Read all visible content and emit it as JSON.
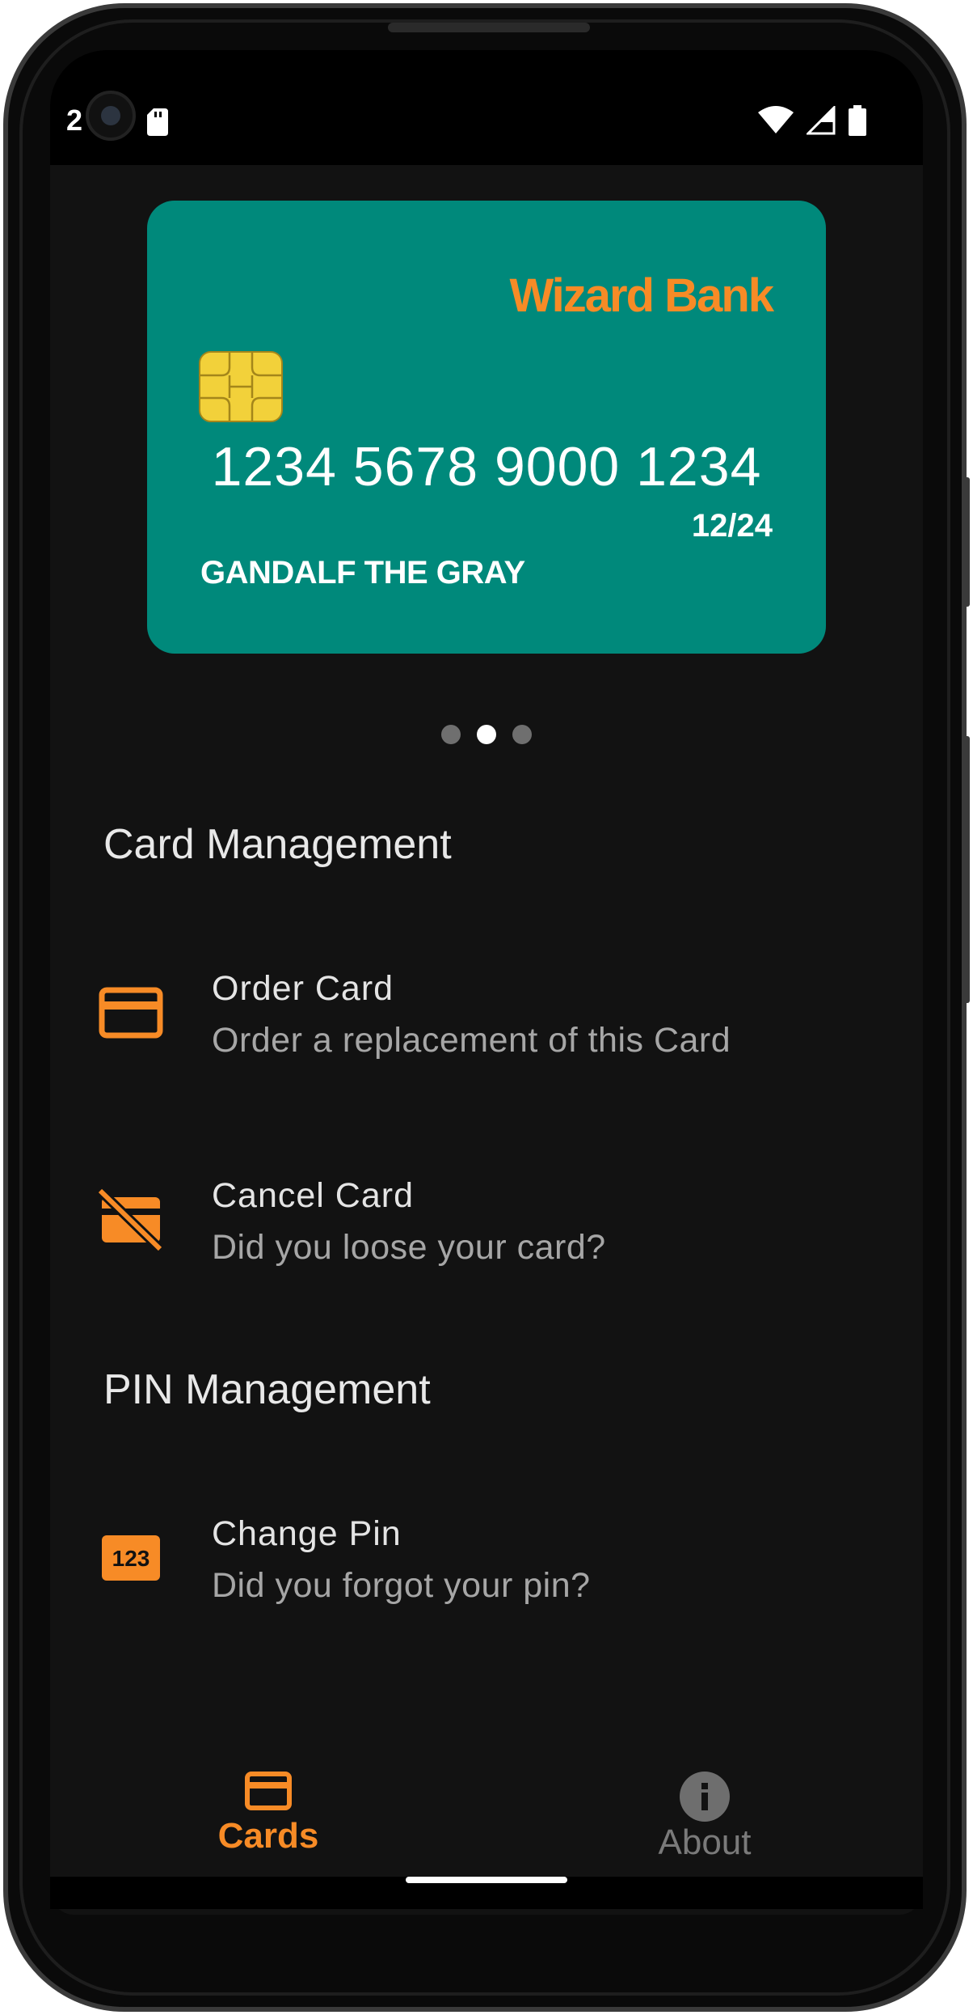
{
  "status_bar": {
    "time": "2",
    "icons": [
      "sd-card-icon",
      "wifi-icon",
      "signal-icon",
      "battery-icon"
    ]
  },
  "card": {
    "bank_name": "Wizard Bank",
    "number": "1234 5678 9000 1234",
    "expiry": "12/24",
    "holder": "GANDALF THE GRAY",
    "color": "#00897b",
    "accent": "#f78b26"
  },
  "pager": {
    "count": 3,
    "active_index": 1
  },
  "sections": {
    "card_management": {
      "title": "Card Management",
      "items": [
        {
          "title": "Order Card",
          "subtitle": "Order a replacement of this Card",
          "icon": "credit-card-icon"
        },
        {
          "title": "Cancel Card",
          "subtitle": "Did you loose your card?",
          "icon": "credit-card-off-icon"
        }
      ]
    },
    "pin_management": {
      "title": "PIN Management",
      "items": [
        {
          "title": "Change Pin",
          "subtitle": "Did you forgot your pin?",
          "icon": "pin-123-icon"
        }
      ]
    }
  },
  "bottom_nav": {
    "items": [
      {
        "label": "Cards",
        "icon": "credit-card-icon",
        "selected": true
      },
      {
        "label": "About",
        "icon": "info-icon",
        "selected": false
      }
    ]
  }
}
